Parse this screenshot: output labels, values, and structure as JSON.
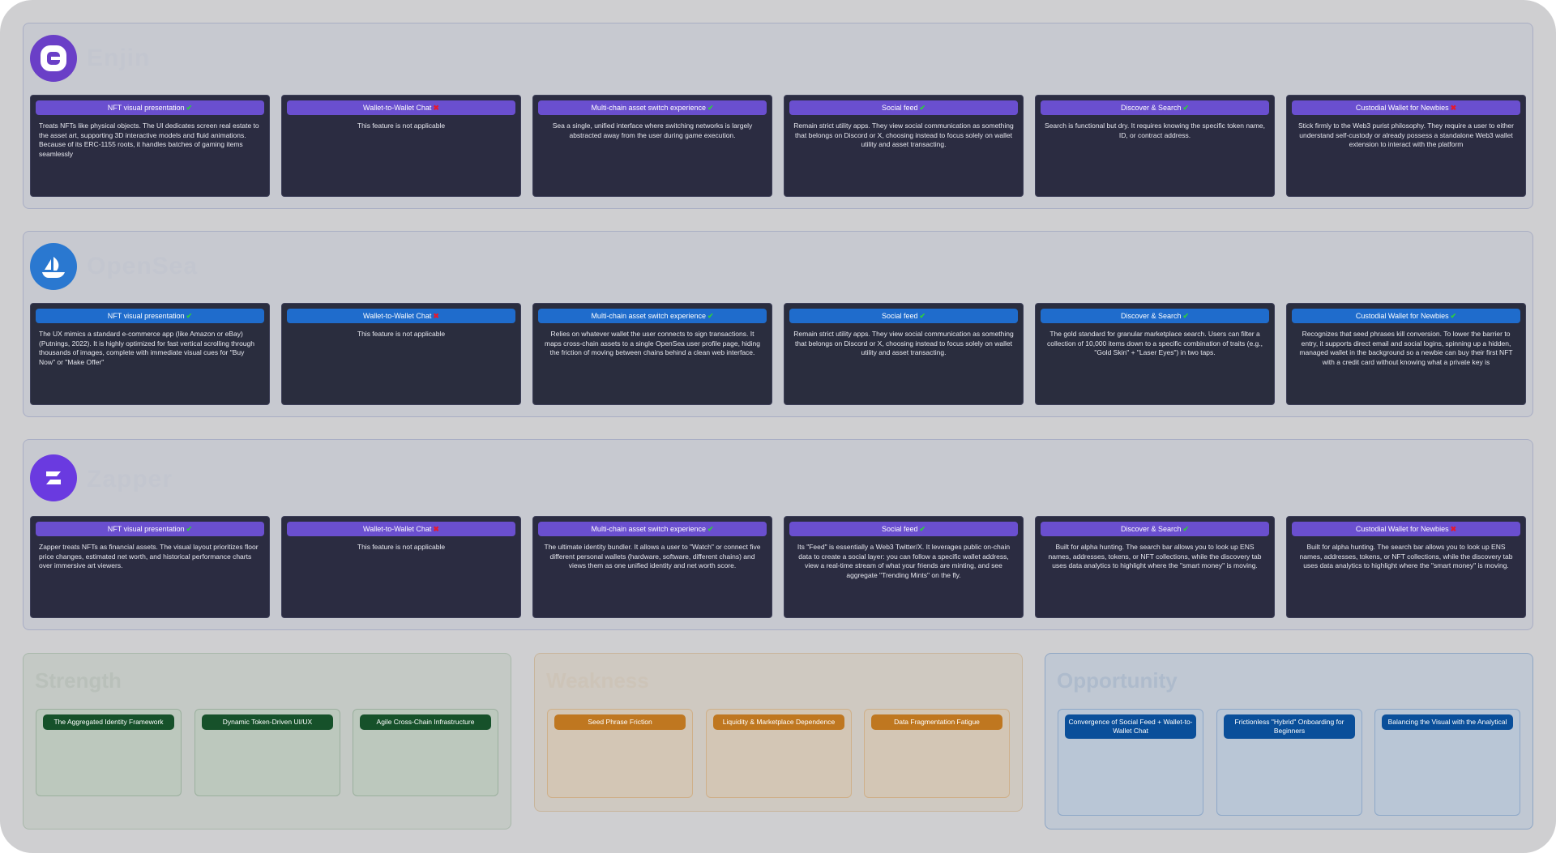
{
  "colors": {
    "enjin_accent": "#6a4fcf",
    "enjin_logo": "#6a3fc7",
    "opensea_accent": "#1f6ccc",
    "opensea_logo": "#2a78d0",
    "zapper_accent": "#6a4fcf",
    "zapper_logo": "#6a3ae0",
    "strength": "#16512a",
    "weakness": "#bf7720",
    "opportunity": "#0a4f9a",
    "check": "#2ecc40",
    "cross": "#e8192c"
  },
  "sections": [
    {
      "name": "Enjin",
      "logo_icon": "enjin-e-icon",
      "description": "",
      "cards": [
        {
          "title": "NFT visual presentation",
          "mark": "✔",
          "status": "yes",
          "body": "Treats NFTs like physical objects. The UI dedicates screen real estate to the asset art, supporting 3D interactive models and fluid animations. Because of its ERC-1155 roots, it handles batches of gaming items seamlessly"
        },
        {
          "title": "Wallet-to-Wallet Chat",
          "mark": "✖",
          "status": "no",
          "body": "This feature is not applicable"
        },
        {
          "title": "Multi-chain asset switch experience",
          "mark": "✔",
          "status": "yes",
          "body": "Sea a single, unified interface where switching networks is largely abstracted away from the user during game execution."
        },
        {
          "title": "Social feed",
          "mark": "✔",
          "status": "yes",
          "body": "Remain strict utility apps. They view social communication as something that belongs on Discord or X, choosing instead to focus solely on wallet utility and asset transacting."
        },
        {
          "title": "Discover & Search",
          "mark": "✔",
          "status": "yes",
          "body": "Search is functional but dry. It requires knowing the specific token name, ID, or contract address."
        },
        {
          "title": "Custodial Wallet for Newbies",
          "mark": "✖",
          "status": "no",
          "body": "Stick firmly to the Web3 purist philosophy. They require a user to either understand self-custody or already possess a standalone Web3 wallet extension to interact with the platform"
        }
      ]
    },
    {
      "name": "OpenSea",
      "logo_icon": "opensea-ship-icon",
      "description": "",
      "cards": [
        {
          "title": "NFT visual presentation",
          "mark": "✔",
          "status": "yes",
          "body": "The UX mimics a standard e-commerce app (like Amazon or eBay) (Putnings, 2022). It is highly optimized for fast vertical scrolling through thousands of images, complete with immediate visual cues for \"Buy Now\" or \"Make Offer\""
        },
        {
          "title": "Wallet-to-Wallet Chat",
          "mark": "✖",
          "status": "no",
          "body": "This feature is not applicable"
        },
        {
          "title": "Multi-chain asset switch experience",
          "mark": "✔",
          "status": "yes",
          "body": "Relies on whatever wallet the user connects to sign transactions. It maps cross-chain assets to a single OpenSea user profile page, hiding the friction of moving between chains behind a clean web interface."
        },
        {
          "title": "Social feed",
          "mark": "✔",
          "status": "yes",
          "body": "Remain strict utility apps. They view social communication as something that belongs on Discord or X, choosing instead to focus solely on wallet utility and asset transacting."
        },
        {
          "title": "Discover & Search",
          "mark": "✔",
          "status": "yes",
          "body": "The gold standard for granular marketplace search. Users can filter a collection of 10,000 items down to a specific combination of traits (e.g., \"Gold Skin\" + \"Laser Eyes\") in two taps."
        },
        {
          "title": "Custodial Wallet for Newbies",
          "mark": "✔",
          "status": "yes",
          "body": "Recognizes that seed phrases kill conversion. To lower the barrier to entry, it supports direct email and social logins, spinning up a hidden, managed wallet in the background so a newbie can buy their first NFT with a credit card without knowing what a private key is"
        }
      ]
    },
    {
      "name": "Zapper",
      "logo_icon": "zapper-z-icon",
      "description": "",
      "cards": [
        {
          "title": "NFT visual presentation",
          "mark": "✔",
          "status": "yes",
          "body": "Zapper treats NFTs as financial assets. The visual layout prioritizes floor price changes, estimated net worth, and historical performance charts over immersive art viewers."
        },
        {
          "title": "Wallet-to-Wallet Chat",
          "mark": "✖",
          "status": "no",
          "body": "This feature is not applicable"
        },
        {
          "title": "Multi-chain asset switch experience",
          "mark": "✔",
          "status": "yes",
          "body": "The ultimate identity bundler. It allows a user to \"Watch\" or connect five different personal wallets (hardware, software, different chains) and views them as one unified identity and net worth score."
        },
        {
          "title": "Social feed",
          "mark": "✔",
          "status": "yes",
          "body": "Its \"Feed\" is essentially a Web3 Twitter/X. It leverages public on-chain data to create a social layer: you can follow a specific wallet address, view a real-time stream of what your friends are minting, and see aggregate \"Trending Mints\" on the fly."
        },
        {
          "title": "Discover & Search",
          "mark": "✔",
          "status": "yes",
          "body": "Built for alpha hunting. The search bar allows you to look up ENS names, addresses, tokens, or NFT collections, while the discovery tab uses data analytics to highlight where the \"smart money\" is moving."
        },
        {
          "title": "Custodial Wallet for Newbies",
          "mark": "✖",
          "status": "no",
          "body": "Built for alpha hunting. The search bar allows you to look up ENS names, addresses, tokens, or NFT collections, while the discovery tab uses data analytics to highlight where the \"smart money\" is moving."
        }
      ]
    }
  ],
  "swot": {
    "strength": {
      "title": "Strength",
      "cards": [
        {
          "title": "The Aggregated Identity Framework",
          "body": ""
        },
        {
          "title": "Dynamic Token-Driven UI/UX",
          "body": ""
        },
        {
          "title": "Agile Cross-Chain Infrastructure",
          "body": ""
        }
      ]
    },
    "weakness": {
      "title": "Weakness",
      "cards": [
        {
          "title": "Seed Phrase Friction",
          "body": ""
        },
        {
          "title": "Liquidity & Marketplace Dependence",
          "body": ""
        },
        {
          "title": "Data Fragmentation Fatigue",
          "body": ""
        }
      ]
    },
    "opportunity": {
      "title": "Opportunity",
      "cards": [
        {
          "title": "Convergence of Social Feed + Wallet-to-Wallet Chat",
          "body": ""
        },
        {
          "title": "Frictionless \"Hybrid\" Onboarding for Beginners",
          "body": ""
        },
        {
          "title": "Balancing the Visual with the Analytical",
          "body": ""
        }
      ]
    }
  }
}
